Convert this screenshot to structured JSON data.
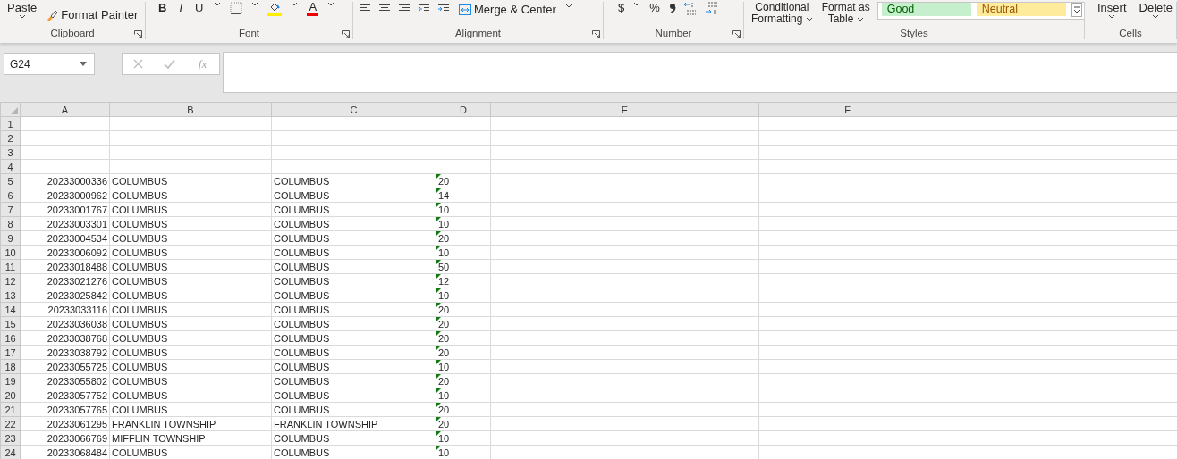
{
  "ribbon": {
    "clipboard": {
      "paste": "Paste",
      "format_painter": "Format Painter",
      "label": "Clipboard"
    },
    "font": {
      "bold": "B",
      "italic": "I",
      "underline": "U",
      "font_color": "A",
      "label": "Font"
    },
    "alignment": {
      "merge": "Merge & Center",
      "label": "Alignment"
    },
    "number": {
      "currency": "$",
      "percent": "%",
      "label": "Number"
    },
    "styles": {
      "conditional": [
        "Conditional",
        "Formatting"
      ],
      "format_table": [
        "Format as",
        "Table"
      ],
      "good": "Good",
      "neutral": "Neutral",
      "label": "Styles"
    },
    "cells": {
      "insert": "Insert",
      "delete": "Delete",
      "label": "Cells"
    }
  },
  "formula_bar": {
    "name_box": "G24",
    "fx": "fx"
  },
  "columns": [
    "A",
    "B",
    "C",
    "D",
    "E",
    "F"
  ],
  "rows": [
    {
      "n": "1"
    },
    {
      "n": "2"
    },
    {
      "n": "3"
    },
    {
      "n": "4"
    },
    {
      "n": "5",
      "a": "20233000336",
      "b": "COLUMBUS",
      "c": "COLUMBUS",
      "d": "20",
      "flagged": true
    },
    {
      "n": "6",
      "a": "20233000962",
      "b": "COLUMBUS",
      "c": "COLUMBUS",
      "d": "14",
      "flagged": true
    },
    {
      "n": "7",
      "a": "20233001767",
      "b": "COLUMBUS",
      "c": "COLUMBUS",
      "d": "10",
      "flagged": true
    },
    {
      "n": "8",
      "a": "20233003301",
      "b": "COLUMBUS",
      "c": "COLUMBUS",
      "d": "10",
      "flagged": true
    },
    {
      "n": "9",
      "a": "20233004534",
      "b": "COLUMBUS",
      "c": "COLUMBUS",
      "d": "20",
      "flagged": true
    },
    {
      "n": "10",
      "a": "20233006092",
      "b": "COLUMBUS",
      "c": "COLUMBUS",
      "d": "10",
      "flagged": true
    },
    {
      "n": "11",
      "a": "20233018488",
      "b": "COLUMBUS",
      "c": "COLUMBUS",
      "d": "50",
      "flagged": true
    },
    {
      "n": "12",
      "a": "20233021276",
      "b": "COLUMBUS",
      "c": "COLUMBUS",
      "d": "12",
      "flagged": true
    },
    {
      "n": "13",
      "a": "20233025842",
      "b": "COLUMBUS",
      "c": "COLUMBUS",
      "d": "10",
      "flagged": true
    },
    {
      "n": "14",
      "a": "20233033116",
      "b": "COLUMBUS",
      "c": "COLUMBUS",
      "d": "20",
      "flagged": true
    },
    {
      "n": "15",
      "a": "20233036038",
      "b": "COLUMBUS",
      "c": "COLUMBUS",
      "d": "20",
      "flagged": true
    },
    {
      "n": "16",
      "a": "20233038768",
      "b": "COLUMBUS",
      "c": "COLUMBUS",
      "d": "20",
      "flagged": true
    },
    {
      "n": "17",
      "a": "20233038792",
      "b": "COLUMBUS",
      "c": "COLUMBUS",
      "d": "20",
      "flagged": true
    },
    {
      "n": "18",
      "a": "20233055725",
      "b": "COLUMBUS",
      "c": "COLUMBUS",
      "d": "10",
      "flagged": true
    },
    {
      "n": "19",
      "a": "20233055802",
      "b": "COLUMBUS",
      "c": "COLUMBUS",
      "d": "20",
      "flagged": true
    },
    {
      "n": "20",
      "a": "20233057752",
      "b": "COLUMBUS",
      "c": "COLUMBUS",
      "d": "10",
      "flagged": true
    },
    {
      "n": "21",
      "a": "20233057765",
      "b": "COLUMBUS",
      "c": "COLUMBUS",
      "d": "20",
      "flagged": true
    },
    {
      "n": "22",
      "a": "20233061295",
      "b": "FRANKLIN TOWNSHIP",
      "c": "FRANKLIN TOWNSHIP",
      "d": "20",
      "flagged": true
    },
    {
      "n": "23",
      "a": "20233066769",
      "b": "MIFFLIN TOWNSHIP",
      "c": "COLUMBUS",
      "d": "10",
      "flagged": true
    },
    {
      "n": "24",
      "a": "20233068484",
      "b": "COLUMBUS",
      "c": "COLUMBUS",
      "d": "10",
      "flagged": true
    }
  ]
}
